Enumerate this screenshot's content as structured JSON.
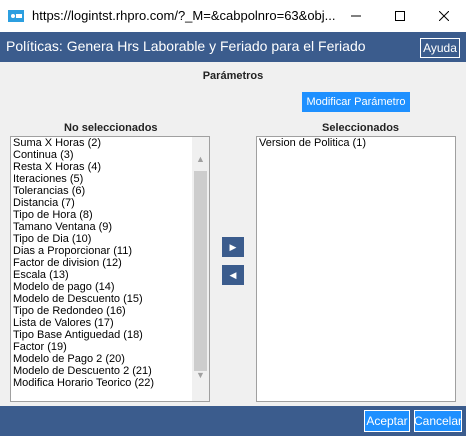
{
  "window": {
    "title": "https://logintst.rhpro.com/?_M=&cabpolnro=63&obj..."
  },
  "header": {
    "title": "Políticas: Genera Hrs Laborable y Feriado para el Feriado",
    "help_label": "Ayuda"
  },
  "params": {
    "label": "Parámetros",
    "modify_label": "Modificar Parámetro"
  },
  "left": {
    "heading": "No seleccionados",
    "items": [
      "Suma X Horas (2)",
      "Continua (3)",
      "Resta X Horas (4)",
      "Iteraciones (5)",
      "Tolerancias (6)",
      "Distancia (7)",
      "Tipo de Hora (8)",
      "Tamano Ventana (9)",
      "Tipo de Dia (10)",
      "Dias a Proporcionar (11)",
      "Factor de division (12)",
      "Escala (13)",
      "Modelo de pago (14)",
      "Modelo de Descuento (15)",
      "Tipo de Redondeo (16)",
      "Lista de Valores (17)",
      "Tipo Base Antiguedad (18)",
      "Factor (19)",
      "Modelo de Pago 2 (20)",
      "Modelo de Descuento 2 (21)",
      "Modifica Horario Teorico (22)"
    ]
  },
  "right": {
    "heading": "Seleccionados",
    "items": [
      "Version de Politica (1)"
    ]
  },
  "footer": {
    "accept_label": "Aceptar",
    "cancel_label": "Cancelar"
  },
  "icons": {
    "move_right": "triangle-right-icon",
    "move_left": "triangle-left-icon"
  },
  "colors": {
    "header_bg": "#3b5c8d",
    "button_bg": "#1e90ff"
  }
}
